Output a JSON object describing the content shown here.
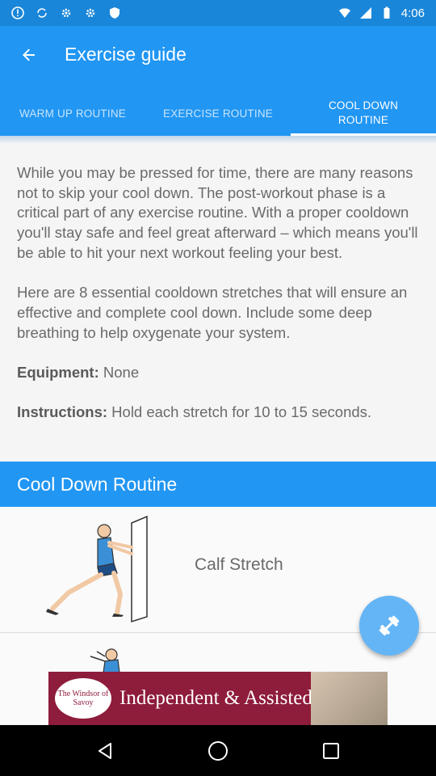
{
  "status_bar": {
    "time": "4:06",
    "icons": [
      "alert-icon",
      "sync-icon",
      "gear-icon",
      "gear-icon",
      "shield-icon",
      "wifi-icon",
      "signal-icon",
      "battery-icon"
    ]
  },
  "header": {
    "title": "Exercise guide",
    "back_icon": "back-arrow-icon"
  },
  "tabs": [
    {
      "label": "WARM UP ROUTINE",
      "active": false
    },
    {
      "label": "EXERCISE ROUTINE",
      "active": false
    },
    {
      "label": "COOL DOWN ROUTINE",
      "active": true
    }
  ],
  "intro": {
    "paragraph1": "While you may be pressed for time, there are many reasons not to skip your cool down. The post-workout phase is a critical part of any exercise routine. With a proper cooldown you'll stay safe and feel great afterward – which means you'll be able to hit your next workout feeling your best.",
    "paragraph2": "Here are 8 essential cooldown stretches that will ensure an effective and complete cool down. Include some deep breathing to help oxygenate your system.",
    "equipment_label": "Equipment:",
    "equipment_value": "None",
    "instructions_label": "Instructions:",
    "instructions_value": "Hold each stretch for 10 to 15 seconds."
  },
  "section": {
    "title": "Cool Down Routine"
  },
  "exercises": [
    {
      "name": "Calf Stretch"
    }
  ],
  "fab": {
    "icon": "dumbbell-icon"
  },
  "ad": {
    "logo_text": "The Windsor of Savoy",
    "headline": "Independent & Assisted Living"
  },
  "colors": {
    "primary": "#2196f3",
    "status": "#1a86d9",
    "fab": "#64b5f6",
    "ad": "#8e1c3b"
  }
}
